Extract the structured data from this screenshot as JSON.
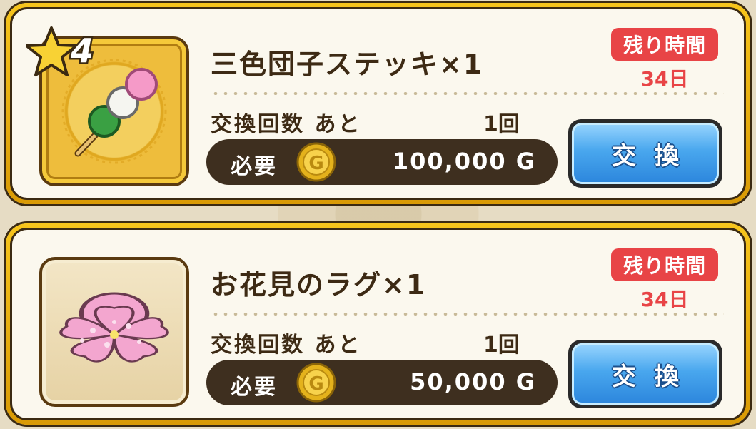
{
  "items": [
    {
      "star_rank": "4",
      "name": "三色団子ステッキ×1",
      "remaining_label": "残り時間",
      "remaining_days": "34日",
      "count_label": "交換回数 あと",
      "count_value": "1回",
      "cost_label": "必要",
      "cost_amount": "100,000 G",
      "exchange_label": "交換",
      "icon": "dango-stick-icon"
    },
    {
      "name": "お花見のラグ×1",
      "remaining_label": "残り時間",
      "remaining_days": "34日",
      "count_label": "交換回数 あと",
      "count_value": "1回",
      "cost_label": "必要",
      "cost_amount": "50,000 G",
      "exchange_label": "交換",
      "icon": "sakura-rug-icon"
    }
  ],
  "colors": {
    "gold_frame": "#f7c51c",
    "remaining_red": "#e84446",
    "button_blue": "#49a7ee",
    "pill_dark": "#3e2f1f"
  }
}
